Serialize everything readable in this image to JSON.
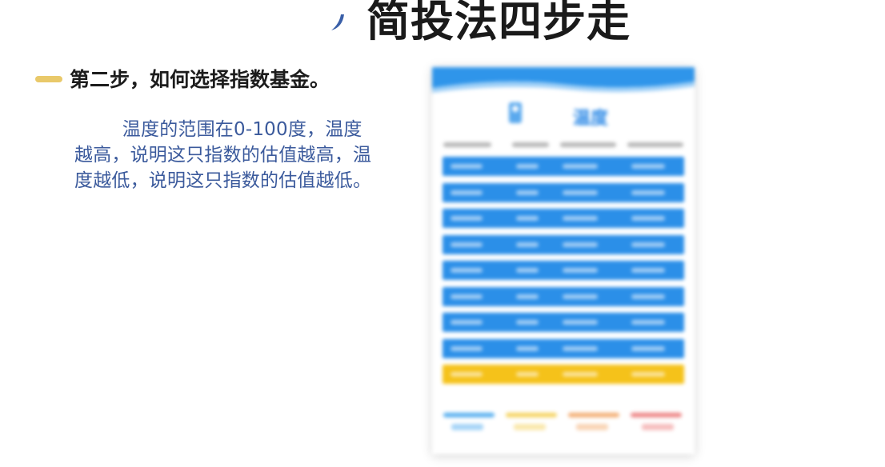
{
  "slide": {
    "title": "简投法四步走",
    "step_heading": "第二步，如何选择指数基金。",
    "paragraph": "温度的范围在0-100度，温度越高，说明这只指数的估值越高，温度越低，说明这只指数的估值越低。"
  },
  "phone": {
    "title": "温度",
    "row_colors": [
      "#2b8fe8",
      "#2b8fe8",
      "#2b8fe8",
      "#2b8fe8",
      "#2b8fe8",
      "#2b8fe8",
      "#2b8fe8",
      "#2b8fe8",
      "#f5c21a"
    ],
    "legend_colors": [
      "#5fb3f0",
      "#f6d66a",
      "#f4b27a",
      "#ee8a8a"
    ]
  }
}
